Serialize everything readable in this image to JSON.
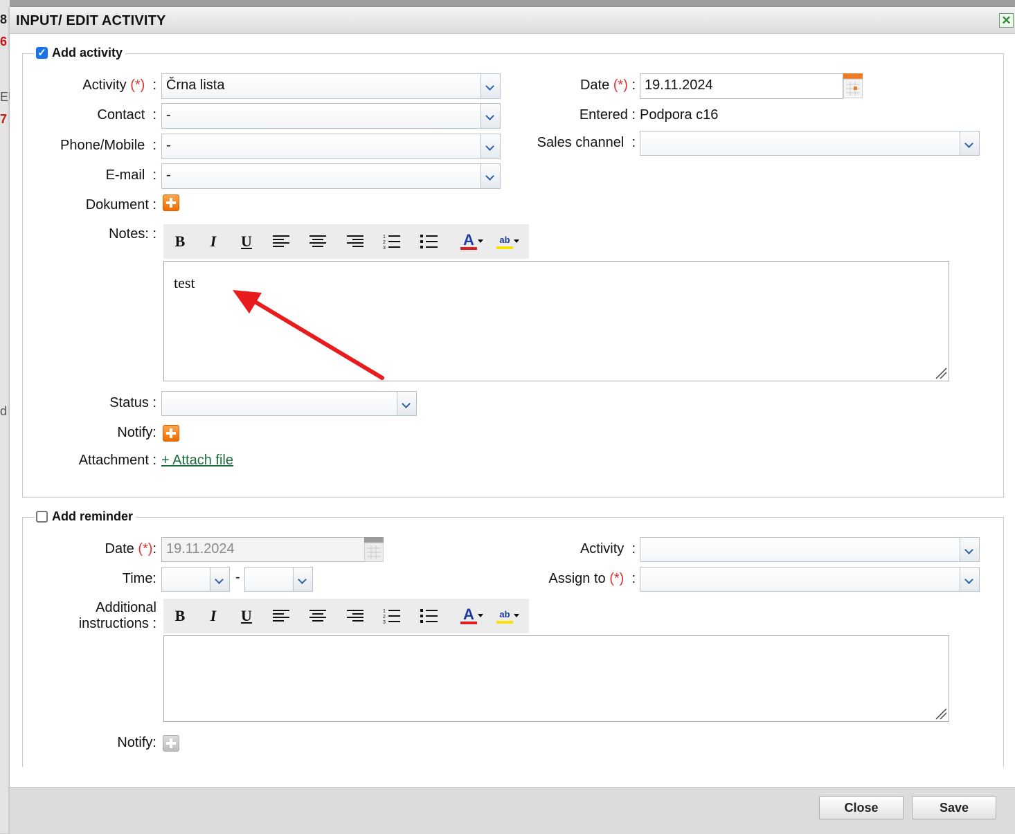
{
  "dialog": {
    "title": "INPUT/ EDIT ACTIVITY",
    "close_icon": "close-icon"
  },
  "background": {
    "c1": "8",
    "c2": "6",
    "c3": "EU",
    "c4": "7",
    "c5": "d"
  },
  "activity_section": {
    "checked": true,
    "legend": "Add activity",
    "activity": {
      "label": "Activity",
      "req": "(*)",
      "colon": ":",
      "value": "Črna lista"
    },
    "contact": {
      "label": "Contact",
      "colon": ":",
      "value": "-"
    },
    "phone": {
      "label": "Phone/Mobile",
      "colon": ":",
      "value": "-"
    },
    "email": {
      "label": "E-mail",
      "colon": ":",
      "value": "-"
    },
    "dokument": {
      "label": "Dokument :"
    },
    "notes": {
      "label": "Notes: :",
      "text": "test"
    },
    "status": {
      "label": "Status :",
      "value": ""
    },
    "notify": {
      "label": "Notify:"
    },
    "attachment": {
      "label": "Attachment :",
      "link": "+ Attach file"
    },
    "date": {
      "label": "Date",
      "req": "(*)",
      "colon": ":",
      "value": "19.11.2024"
    },
    "entered": {
      "label": "Entered :",
      "value": "Podpora c16"
    },
    "sales_channel": {
      "label": "Sales channel",
      "colon": ":",
      "value": ""
    }
  },
  "reminder_section": {
    "checked": false,
    "legend": "Add reminder",
    "date": {
      "label": "Date",
      "req": "(*)",
      "colon": ":",
      "value": "19.11.2024"
    },
    "time": {
      "label": "Time:",
      "from": "",
      "sep": "-",
      "to": ""
    },
    "instructions": {
      "label_line1": "Additional",
      "label_line2": "instructions :",
      "text": ""
    },
    "notify": {
      "label": "Notify:"
    },
    "activity": {
      "label": "Activity",
      "colon": ":",
      "value": ""
    },
    "assign": {
      "label": "Assign to",
      "req": "(*)",
      "colon": ":",
      "value": ""
    }
  },
  "toolbar_icons": [
    "bold-icon",
    "italic-icon",
    "underline-icon",
    "align-left-icon",
    "align-center-icon",
    "align-right-icon",
    "ordered-list-icon",
    "bullet-list-icon",
    "font-color-icon",
    "highlight-color-icon"
  ],
  "toolbar_glyphs": {
    "bold": "B",
    "italic": "I",
    "underline": "U",
    "font_color": "A",
    "highlight": "ab"
  },
  "colors": {
    "accent": "#1a73e8",
    "required": "#e03030",
    "annotation_arrow": "#e81c1c",
    "font_color_bar": "#e02020",
    "highlight_bar": "#f5e400"
  },
  "footer": {
    "close_label": "Close",
    "save_label": "Save"
  }
}
